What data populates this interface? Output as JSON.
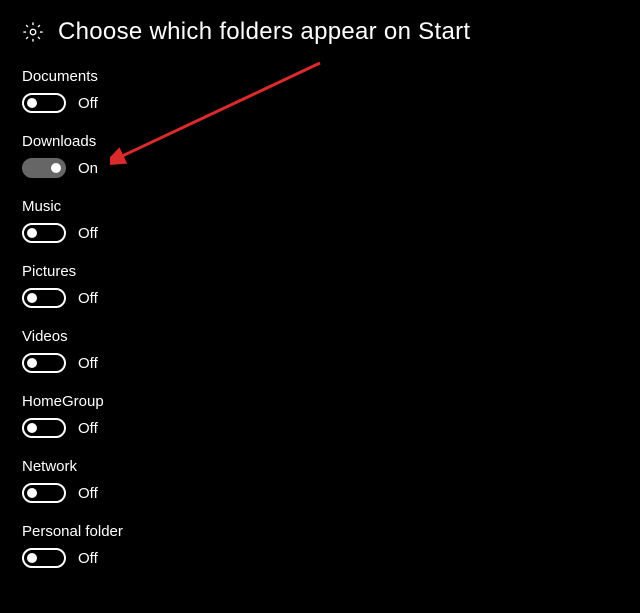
{
  "page": {
    "title": "Choose which folders appear on Start"
  },
  "stateText": {
    "on": "On",
    "off": "Off"
  },
  "settings": [
    {
      "name": "Documents",
      "on": false
    },
    {
      "name": "Downloads",
      "on": true
    },
    {
      "name": "Music",
      "on": false
    },
    {
      "name": "Pictures",
      "on": false
    },
    {
      "name": "Videos",
      "on": false
    },
    {
      "name": "HomeGroup",
      "on": false
    },
    {
      "name": "Network",
      "on": false
    },
    {
      "name": "Personal folder",
      "on": false
    }
  ],
  "annotation": {
    "type": "arrow",
    "color": "#d92b2b",
    "pointsTo": "downloads-toggle"
  }
}
